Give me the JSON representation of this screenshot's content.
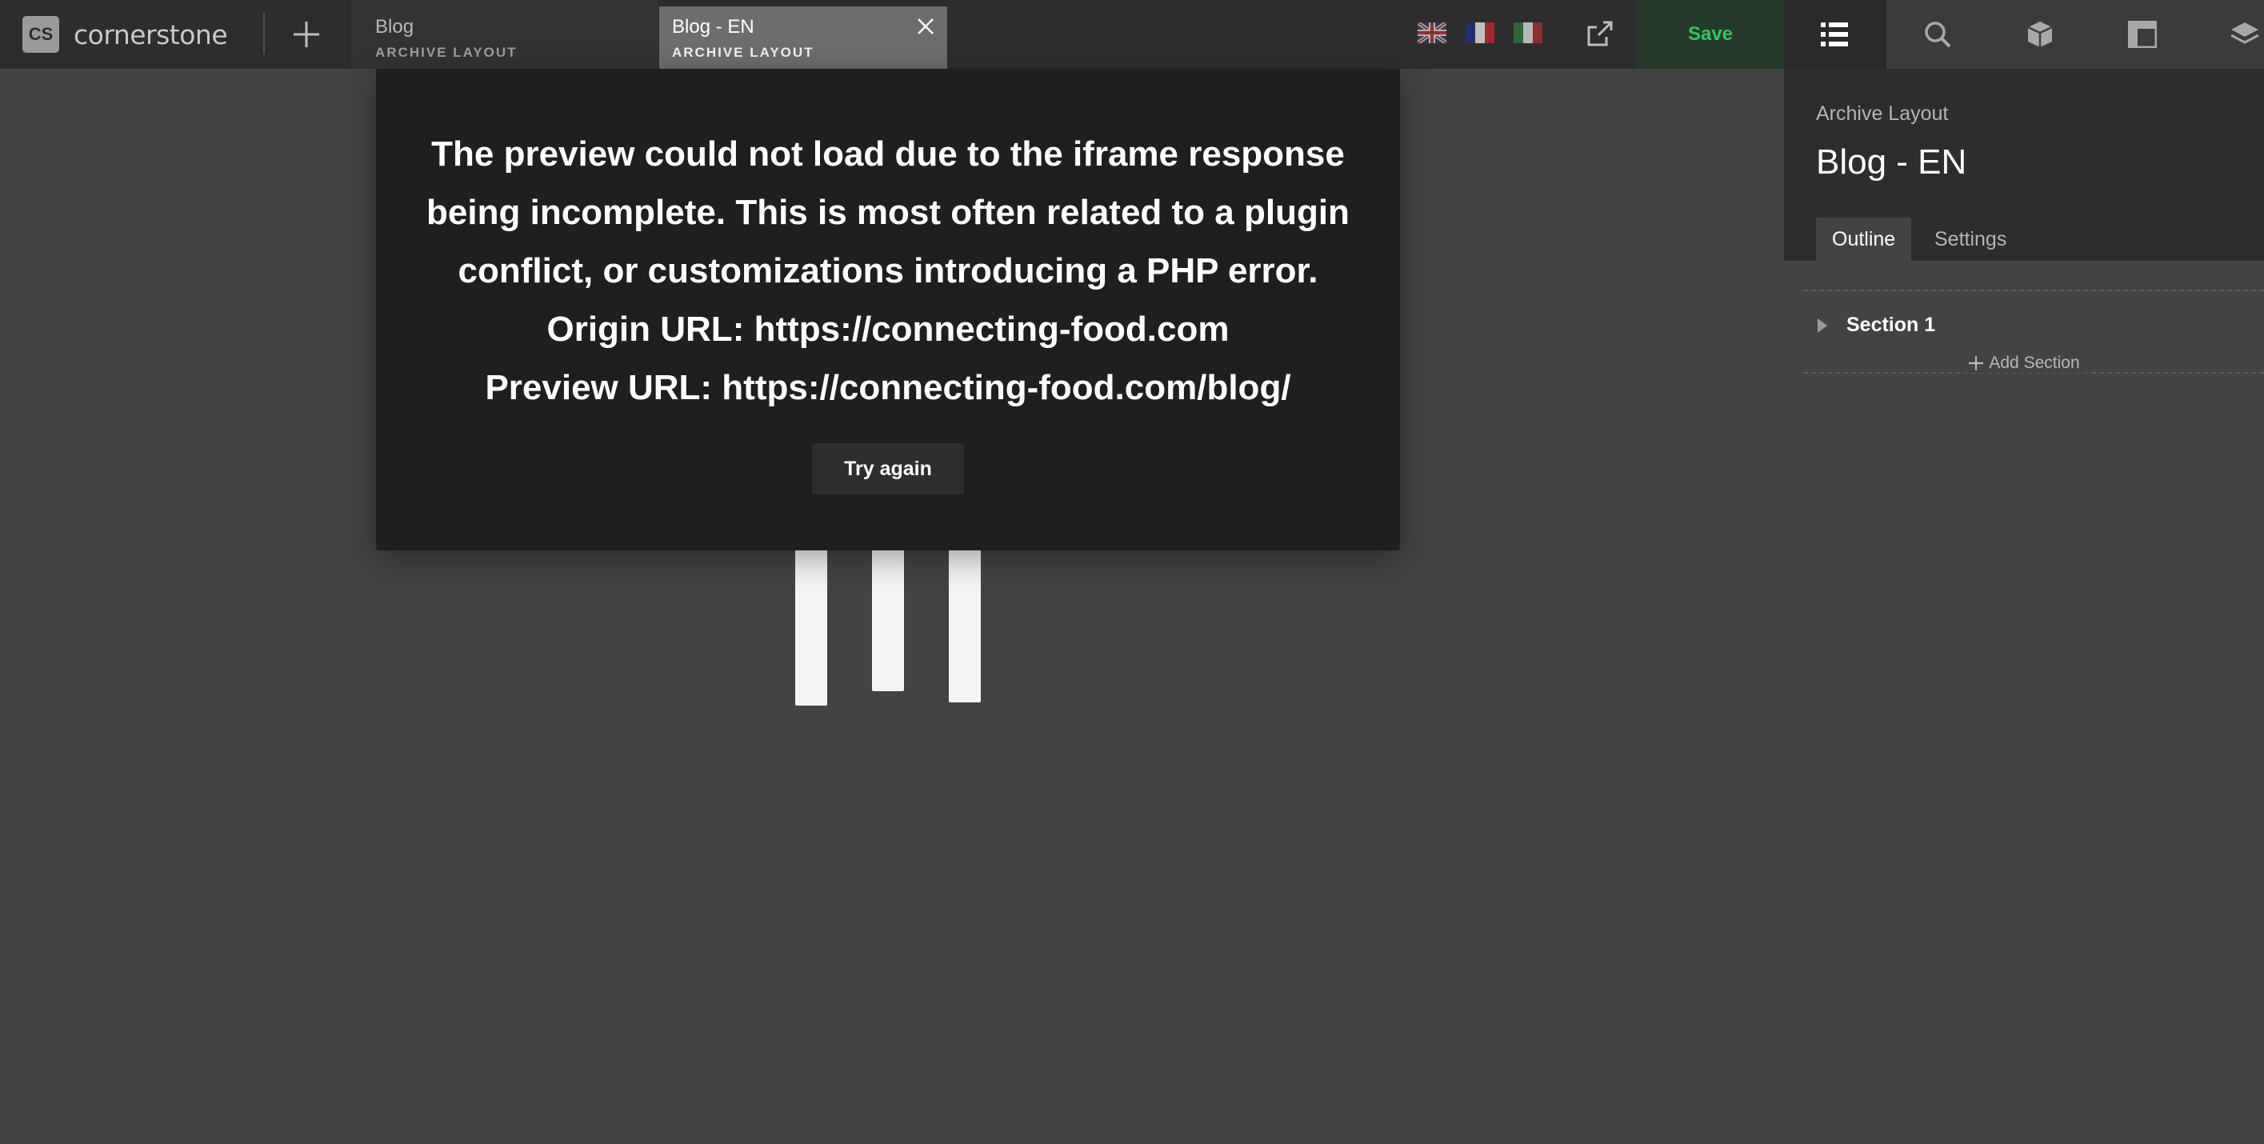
{
  "app": {
    "logo_badge": "CS",
    "logo_text": "cornerstone"
  },
  "tabs": [
    {
      "title": "Blog",
      "subtitle": "ARCHIVE LAYOUT",
      "active": false
    },
    {
      "title": "Blog - EN",
      "subtitle": "ARCHIVE LAYOUT",
      "active": true
    }
  ],
  "languages": [
    "en-flag-icon",
    "fr-flag-icon",
    "it-flag-icon"
  ],
  "toolbar": {
    "save_label": "Save",
    "icons": [
      "outline-list-icon",
      "search-icon",
      "element-cube-icon",
      "layout-icon",
      "layers-icon"
    ]
  },
  "error": {
    "lines": [
      "The preview could not load due to the iframe response",
      "being incomplete. This is most often related to a plugin",
      "conflict, or customizations introducing a PHP error."
    ],
    "origin_url": "Origin URL: https://connecting-food.com",
    "preview_url": "Preview URL: https://connecting-food.com/blog/",
    "retry_label": "Try again"
  },
  "panel": {
    "kicker": "Archive Layout",
    "title": "Blog - EN",
    "tabs": [
      "Outline",
      "Settings"
    ],
    "section_label": "Section 1",
    "add_section_label": "Add Section"
  },
  "colors": {
    "save_text": "#34c759",
    "save_bg": "#263a2b",
    "topbar": "#2d2d2d",
    "canvas": "#434343",
    "modal": "#1f1f1f"
  }
}
